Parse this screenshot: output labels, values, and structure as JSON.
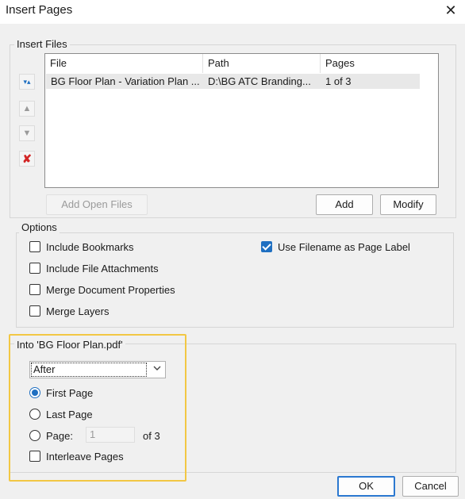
{
  "window": {
    "title": "Insert Pages",
    "close_glyph": "✕"
  },
  "insert_files": {
    "legend": "Insert Files",
    "columns": [
      "File",
      "Path",
      "Pages"
    ],
    "rows": [
      {
        "file": "BG Floor Plan - Variation Plan ...",
        "path": "D:\\BG ATC Branding...",
        "pages": "1 of 3"
      }
    ],
    "side_buttons": {
      "top_glyph": "▾▴",
      "up_glyph": "▲",
      "down_glyph": "▼",
      "remove_glyph": "✘"
    },
    "add_open_files": "Add Open Files",
    "add": "Add",
    "modify": "Modify"
  },
  "options": {
    "legend": "Options",
    "include_bookmarks": "Include Bookmarks",
    "include_file_attachments": "Include File Attachments",
    "merge_document_properties": "Merge Document Properties",
    "merge_layers": "Merge Layers",
    "use_filename_as_page_label": "Use Filename as Page Label"
  },
  "into": {
    "legend": "Into 'BG Floor Plan.pdf'",
    "position_value": "After",
    "first_page": "First Page",
    "last_page": "Last Page",
    "page": "Page:",
    "page_number": "1",
    "of_total": "of 3",
    "interleave_pages": "Interleave Pages"
  },
  "footer": {
    "ok": "OK",
    "cancel": "Cancel"
  },
  "colors": {
    "accent": "#1f6fc1",
    "remove_red": "#d22424",
    "highlight": "#f2c744"
  }
}
